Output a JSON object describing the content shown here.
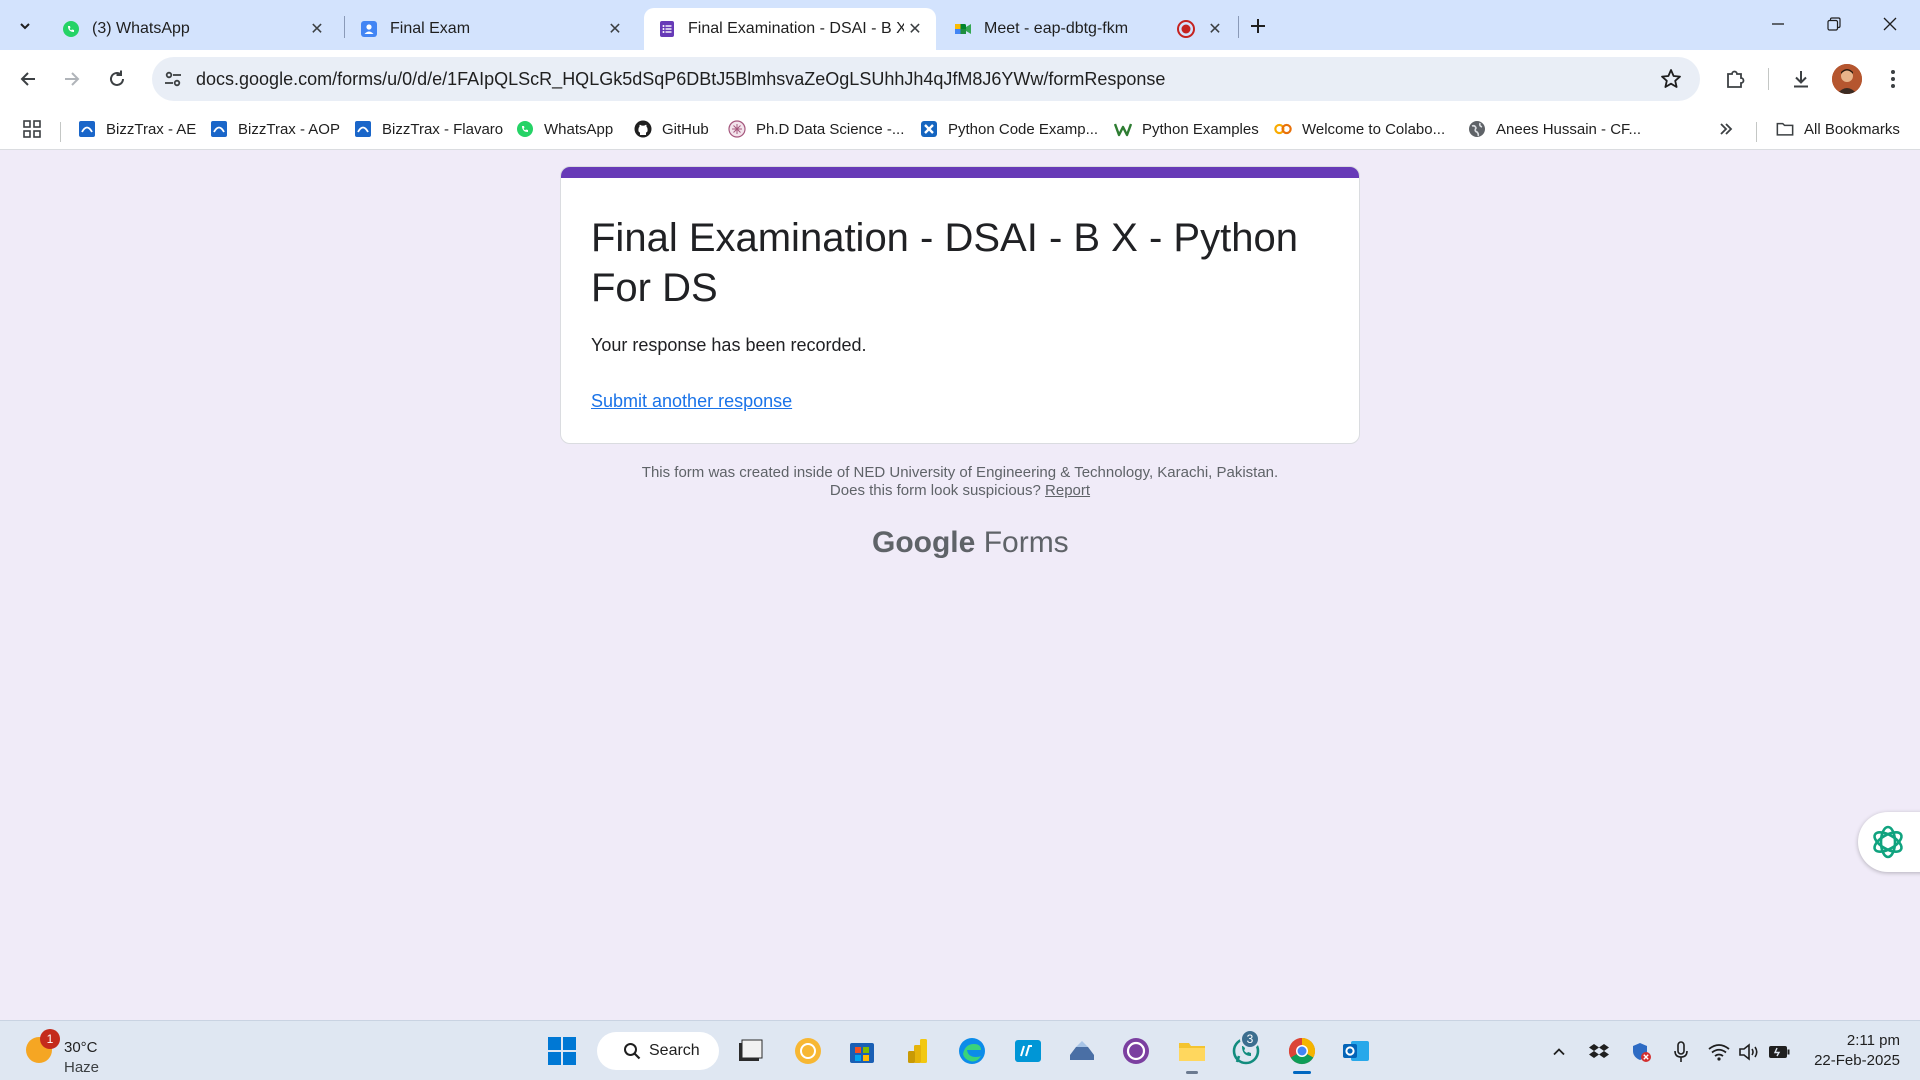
{
  "browser": {
    "tabs": [
      {
        "title": "(3) WhatsApp",
        "icon": "whatsapp-icon"
      },
      {
        "title": "Final Exam",
        "icon": "google-forms-person-icon"
      },
      {
        "title": "Final Examination - DSAI - B X -",
        "icon": "google-forms-icon",
        "active": true
      },
      {
        "title": "Meet - eap-dbtg-fkm",
        "icon": "google-meet-icon",
        "recording": true
      }
    ],
    "url": "docs.google.com/forms/u/0/d/e/1FAIpQLScR_HQLGk5dSqP6DBtJ5BlmhsvaZeOgLSUhhJh4qJfM8J6YWw/formResponse",
    "bookmarks": [
      {
        "label": "BizzTrax - AE",
        "icon": "bizztrax-icon"
      },
      {
        "label": "BizzTrax - AOP",
        "icon": "bizztrax-icon"
      },
      {
        "label": "BizzTrax - Flavaro",
        "icon": "bizztrax-icon"
      },
      {
        "label": "WhatsApp",
        "icon": "whatsapp-icon"
      },
      {
        "label": "GitHub",
        "icon": "github-icon"
      },
      {
        "label": "Ph.D Data Science -...",
        "icon": "phd-icon"
      },
      {
        "label": "Python Code Examp...",
        "icon": "python-code-icon"
      },
      {
        "label": "Python Examples",
        "icon": "w-icon"
      },
      {
        "label": "Welcome to Colabo...",
        "icon": "colab-icon"
      },
      {
        "label": "Anees Hussain - CF...",
        "icon": "globe-icon"
      }
    ],
    "all_bookmarks": "All Bookmarks"
  },
  "form": {
    "title": "Final Examination - DSAI - B X - Python For DS",
    "message": "Your response has been recorded.",
    "another_link": "Submit another response",
    "footer_line1": "This form was created inside of NED University of Engineering & Technology, Karachi, Pakistan.",
    "footer_line2": "Does this form look suspicious?",
    "report": "Report",
    "brand_google": "Google",
    "brand_forms": "Forms",
    "accent": "#673ab7"
  },
  "taskbar": {
    "weather": {
      "temp": "30°C",
      "condition": "Haze",
      "alerts": "1"
    },
    "search_label": "Search",
    "whatsapp_badge": "3",
    "time": "2:11 pm",
    "date": "22-Feb-2025"
  }
}
